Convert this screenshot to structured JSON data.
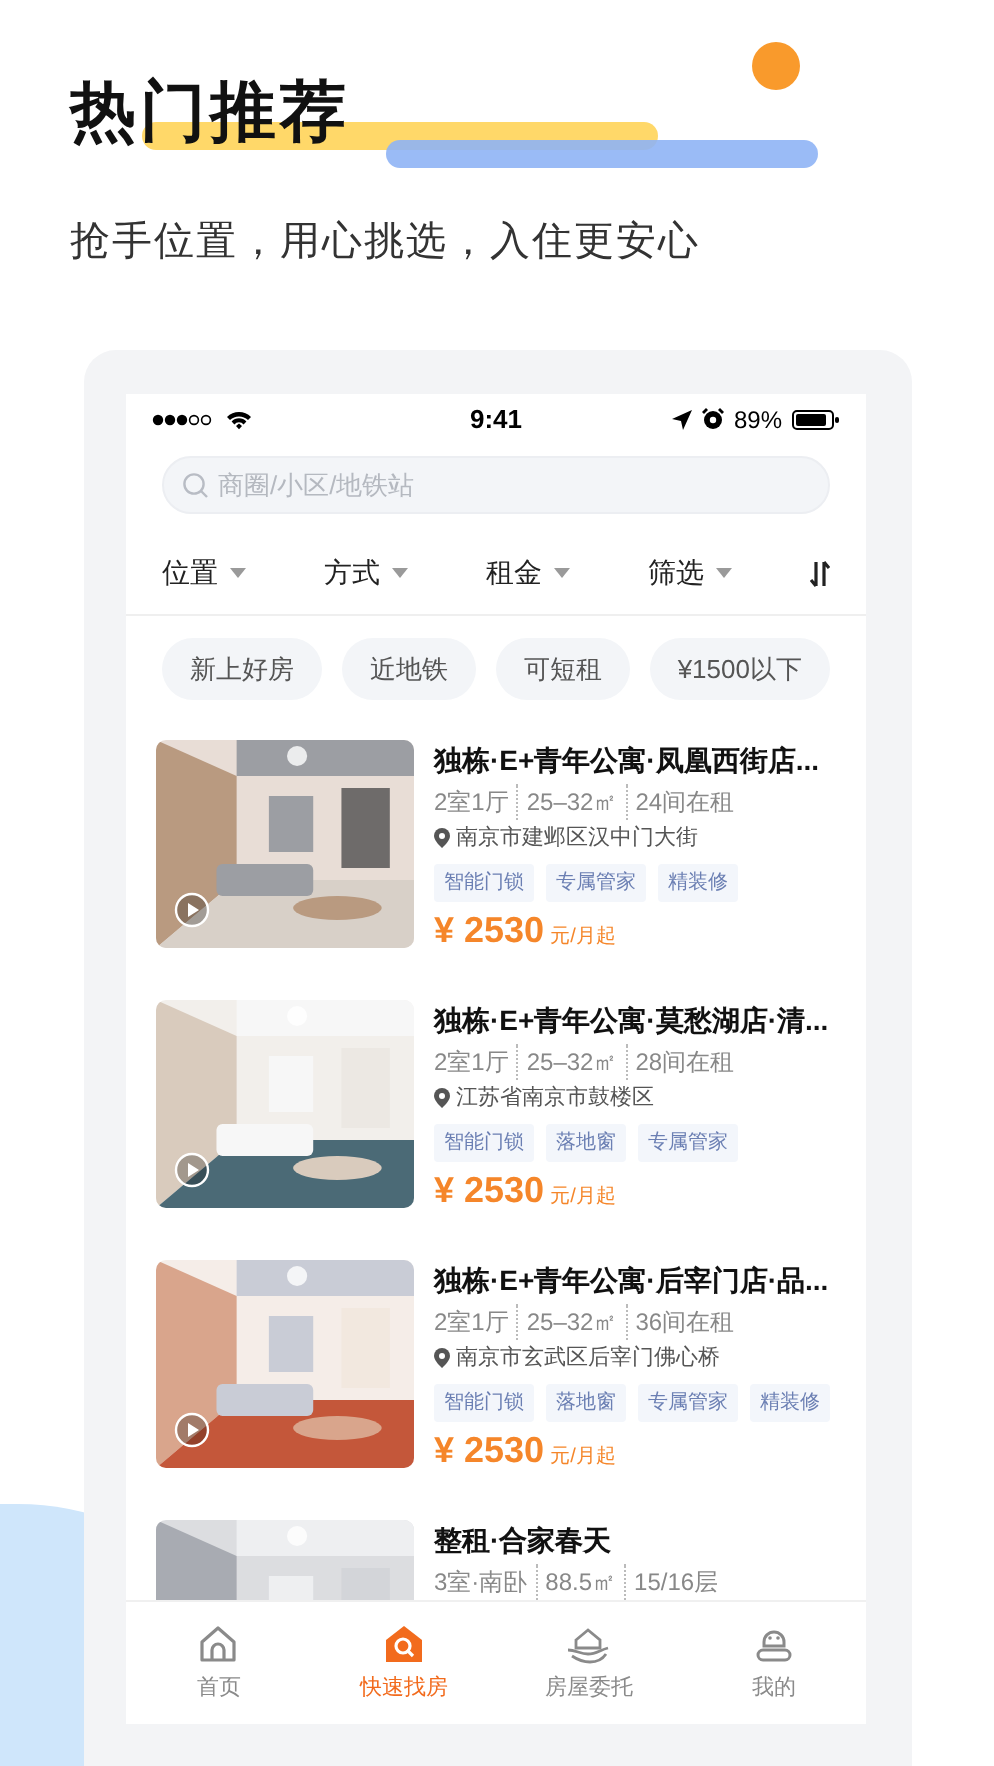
{
  "header": {
    "title": "热门推荐",
    "subtitle": "抢手位置，用心挑选，入住更安心"
  },
  "status_bar": {
    "time": "9:41",
    "battery": "89%"
  },
  "search": {
    "placeholder": "商圈/小区/地铁站"
  },
  "filters": [
    {
      "label": "位置"
    },
    {
      "label": "方式"
    },
    {
      "label": "租金"
    },
    {
      "label": "筛选"
    }
  ],
  "chips": [
    "新上好房",
    "近地铁",
    "可短租",
    "¥1500以下"
  ],
  "listings": [
    {
      "title": "独栋·E+青年公寓·凤凰西街店...",
      "specs": [
        "2室1厅",
        "25–32㎡",
        "24间在租"
      ],
      "address": "南京市建邺区汉中门大街",
      "tags": [
        "智能门锁",
        "专属管家",
        "精装修"
      ],
      "price": "¥ 2530",
      "unit": "元/月起"
    },
    {
      "title": "独栋·E+青年公寓·莫愁湖店·清...",
      "specs": [
        "2室1厅",
        "25–32㎡",
        "28间在租"
      ],
      "address": "江苏省南京市鼓楼区",
      "tags": [
        "智能门锁",
        "落地窗",
        "专属管家"
      ],
      "price": "¥ 2530",
      "unit": "元/月起"
    },
    {
      "title": "独栋·E+青年公寓·后宰门店·品...",
      "specs": [
        "2室1厅",
        "25–32㎡",
        "36间在租"
      ],
      "address": "南京市玄武区后宰门佛心桥",
      "tags": [
        "智能门锁",
        "落地窗",
        "专属管家",
        "精装修"
      ],
      "price": "¥ 2530",
      "unit": "元/月起"
    },
    {
      "title": "整租·合家春天",
      "specs": [
        "3室·南卧",
        "88.5㎡",
        "15/16层"
      ]
    }
  ],
  "tab_bar": [
    {
      "label": "首页",
      "selected": false
    },
    {
      "label": "快速找房",
      "selected": true
    },
    {
      "label": "房屋委托",
      "selected": false
    },
    {
      "label": "我的",
      "selected": false
    }
  ]
}
